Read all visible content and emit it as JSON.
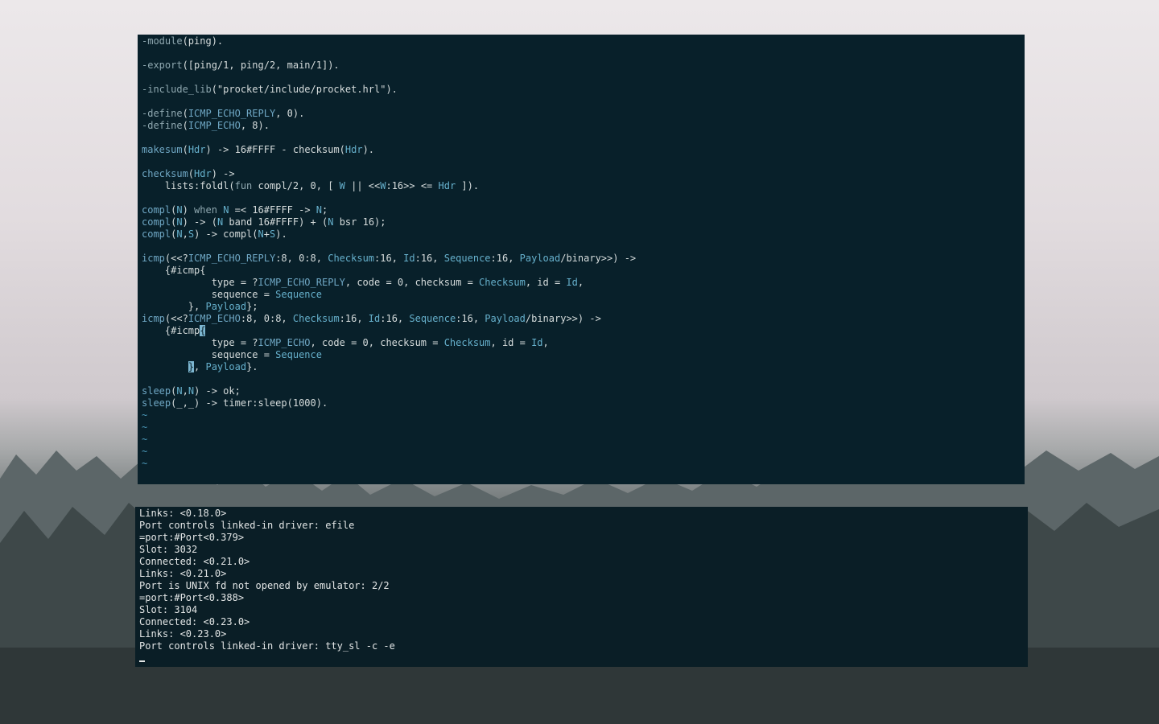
{
  "editor": {
    "lines": [
      {
        "segs": [
          {
            "c": "kw",
            "t": "-module"
          },
          {
            "c": "",
            "t": "(ping)."
          }
        ]
      },
      {
        "segs": []
      },
      {
        "segs": [
          {
            "c": "kw",
            "t": "-export"
          },
          {
            "c": "",
            "t": "([ping/1, ping/2, main/1])."
          }
        ]
      },
      {
        "segs": []
      },
      {
        "segs": [
          {
            "c": "kw",
            "t": "-include_lib"
          },
          {
            "c": "",
            "t": "(\"procket/include/procket.hrl\")."
          }
        ]
      },
      {
        "segs": []
      },
      {
        "segs": [
          {
            "c": "kw",
            "t": "-define"
          },
          {
            "c": "",
            "t": "("
          },
          {
            "c": "mac",
            "t": "ICMP_ECHO_REPLY"
          },
          {
            "c": "",
            "t": ", 0)."
          }
        ]
      },
      {
        "segs": [
          {
            "c": "kw",
            "t": "-define"
          },
          {
            "c": "",
            "t": "("
          },
          {
            "c": "mac",
            "t": "ICMP_ECHO"
          },
          {
            "c": "",
            "t": ", 8)."
          }
        ]
      },
      {
        "segs": []
      },
      {
        "segs": [
          {
            "c": "fn",
            "t": "makesum"
          },
          {
            "c": "",
            "t": "("
          },
          {
            "c": "var",
            "t": "Hdr"
          },
          {
            "c": "",
            "t": ") -> 16#FFFF - checksum("
          },
          {
            "c": "var",
            "t": "Hdr"
          },
          {
            "c": "",
            "t": ")."
          }
        ]
      },
      {
        "segs": []
      },
      {
        "segs": [
          {
            "c": "fn",
            "t": "checksum"
          },
          {
            "c": "",
            "t": "("
          },
          {
            "c": "var",
            "t": "Hdr"
          },
          {
            "c": "",
            "t": ") ->"
          }
        ]
      },
      {
        "segs": [
          {
            "c": "",
            "t": "    lists:foldl("
          },
          {
            "c": "kw",
            "t": "fun"
          },
          {
            "c": "",
            "t": " compl/2, 0, [ "
          },
          {
            "c": "var",
            "t": "W"
          },
          {
            "c": "",
            "t": " || <<"
          },
          {
            "c": "var",
            "t": "W"
          },
          {
            "c": "",
            "t": ":16>> <= "
          },
          {
            "c": "var",
            "t": "Hdr"
          },
          {
            "c": "",
            "t": " ])."
          }
        ]
      },
      {
        "segs": []
      },
      {
        "segs": [
          {
            "c": "fn",
            "t": "compl"
          },
          {
            "c": "",
            "t": "("
          },
          {
            "c": "var",
            "t": "N"
          },
          {
            "c": "",
            "t": ") "
          },
          {
            "c": "kw",
            "t": "when"
          },
          {
            "c": "",
            "t": " "
          },
          {
            "c": "var",
            "t": "N"
          },
          {
            "c": "",
            "t": " =< 16#FFFF -> "
          },
          {
            "c": "var",
            "t": "N"
          },
          {
            "c": "",
            "t": ";"
          }
        ]
      },
      {
        "segs": [
          {
            "c": "fn",
            "t": "compl"
          },
          {
            "c": "",
            "t": "("
          },
          {
            "c": "var",
            "t": "N"
          },
          {
            "c": "",
            "t": ") -> ("
          },
          {
            "c": "var",
            "t": "N"
          },
          {
            "c": "",
            "t": " band 16#FFFF) + ("
          },
          {
            "c": "var",
            "t": "N"
          },
          {
            "c": "",
            "t": " bsr 16);"
          }
        ]
      },
      {
        "segs": [
          {
            "c": "fn",
            "t": "compl"
          },
          {
            "c": "",
            "t": "("
          },
          {
            "c": "var",
            "t": "N"
          },
          {
            "c": "",
            "t": ","
          },
          {
            "c": "var",
            "t": "S"
          },
          {
            "c": "",
            "t": ") -> compl("
          },
          {
            "c": "var",
            "t": "N"
          },
          {
            "c": "",
            "t": "+"
          },
          {
            "c": "var",
            "t": "S"
          },
          {
            "c": "",
            "t": ")."
          }
        ]
      },
      {
        "segs": []
      },
      {
        "segs": [
          {
            "c": "fn",
            "t": "icmp"
          },
          {
            "c": "",
            "t": "(<<?"
          },
          {
            "c": "mac",
            "t": "ICMP_ECHO_REPLY"
          },
          {
            "c": "",
            "t": ":8, 0:8, "
          },
          {
            "c": "var",
            "t": "Checksum"
          },
          {
            "c": "",
            "t": ":16, "
          },
          {
            "c": "var",
            "t": "Id"
          },
          {
            "c": "",
            "t": ":16, "
          },
          {
            "c": "var",
            "t": "Sequence"
          },
          {
            "c": "",
            "t": ":16, "
          },
          {
            "c": "var",
            "t": "Payload"
          },
          {
            "c": "",
            "t": "/binary>>) ->"
          }
        ]
      },
      {
        "segs": [
          {
            "c": "",
            "t": "    {#icmp{"
          }
        ]
      },
      {
        "segs": [
          {
            "c": "",
            "t": "            type = ?"
          },
          {
            "c": "mac",
            "t": "ICMP_ECHO_REPLY"
          },
          {
            "c": "",
            "t": ", code = 0, checksum = "
          },
          {
            "c": "var",
            "t": "Checksum"
          },
          {
            "c": "",
            "t": ", id = "
          },
          {
            "c": "var",
            "t": "Id"
          },
          {
            "c": "",
            "t": ","
          }
        ]
      },
      {
        "segs": [
          {
            "c": "",
            "t": "            sequence = "
          },
          {
            "c": "var",
            "t": "Sequence"
          }
        ]
      },
      {
        "segs": [
          {
            "c": "",
            "t": "        }, "
          },
          {
            "c": "var",
            "t": "Payload"
          },
          {
            "c": "",
            "t": "};"
          }
        ]
      },
      {
        "segs": [
          {
            "c": "fn",
            "t": "icmp"
          },
          {
            "c": "",
            "t": "(<<?"
          },
          {
            "c": "mac",
            "t": "ICMP_ECHO"
          },
          {
            "c": "",
            "t": ":8, 0:8, "
          },
          {
            "c": "var",
            "t": "Checksum"
          },
          {
            "c": "",
            "t": ":16, "
          },
          {
            "c": "var",
            "t": "Id"
          },
          {
            "c": "",
            "t": ":16, "
          },
          {
            "c": "var",
            "t": "Sequence"
          },
          {
            "c": "",
            "t": ":16, "
          },
          {
            "c": "var",
            "t": "Payload"
          },
          {
            "c": "",
            "t": "/binary>>) ->"
          }
        ]
      },
      {
        "segs": [
          {
            "c": "",
            "t": "    {#icmp"
          },
          {
            "c": "cursor-block",
            "t": "{"
          }
        ]
      },
      {
        "segs": [
          {
            "c": "",
            "t": "            type = ?"
          },
          {
            "c": "mac",
            "t": "ICMP_ECHO"
          },
          {
            "c": "",
            "t": ", code = 0, checksum = "
          },
          {
            "c": "var",
            "t": "Checksum"
          },
          {
            "c": "",
            "t": ", id = "
          },
          {
            "c": "var",
            "t": "Id"
          },
          {
            "c": "",
            "t": ","
          }
        ]
      },
      {
        "segs": [
          {
            "c": "",
            "t": "            sequence = "
          },
          {
            "c": "var",
            "t": "Sequence"
          }
        ]
      },
      {
        "segs": [
          {
            "c": "",
            "t": "        "
          },
          {
            "c": "cursor-block",
            "t": "}"
          },
          {
            "c": "",
            "t": ", "
          },
          {
            "c": "var",
            "t": "Payload"
          },
          {
            "c": "",
            "t": "}."
          }
        ]
      },
      {
        "segs": []
      },
      {
        "segs": [
          {
            "c": "fn",
            "t": "sleep"
          },
          {
            "c": "",
            "t": "("
          },
          {
            "c": "var",
            "t": "N"
          },
          {
            "c": "",
            "t": ","
          },
          {
            "c": "var",
            "t": "N"
          },
          {
            "c": "",
            "t": ") -> ok;"
          }
        ]
      },
      {
        "segs": [
          {
            "c": "fn",
            "t": "sleep"
          },
          {
            "c": "",
            "t": "(_,_) -> timer:sleep(1000)."
          }
        ]
      },
      {
        "segs": [
          {
            "c": "tilde",
            "t": "~"
          }
        ]
      },
      {
        "segs": [
          {
            "c": "tilde",
            "t": "~"
          }
        ]
      },
      {
        "segs": [
          {
            "c": "tilde",
            "t": "~"
          }
        ]
      },
      {
        "segs": [
          {
            "c": "tilde",
            "t": "~"
          }
        ]
      },
      {
        "segs": [
          {
            "c": "tilde",
            "t": "~"
          }
        ]
      }
    ]
  },
  "console": {
    "lines": [
      "Links: <0.18.0>",
      "Port controls linked-in driver: efile",
      "=port:#Port<0.379>",
      "Slot: 3032",
      "Connected: <0.21.0>",
      "Links: <0.21.0>",
      "Port is UNIX fd not opened by emulator: 2/2",
      "=port:#Port<0.388>",
      "Slot: 3104",
      "Connected: <0.23.0>",
      "Links: <0.23.0>",
      "Port controls linked-in driver: tty_sl -c -e",
      ""
    ]
  }
}
